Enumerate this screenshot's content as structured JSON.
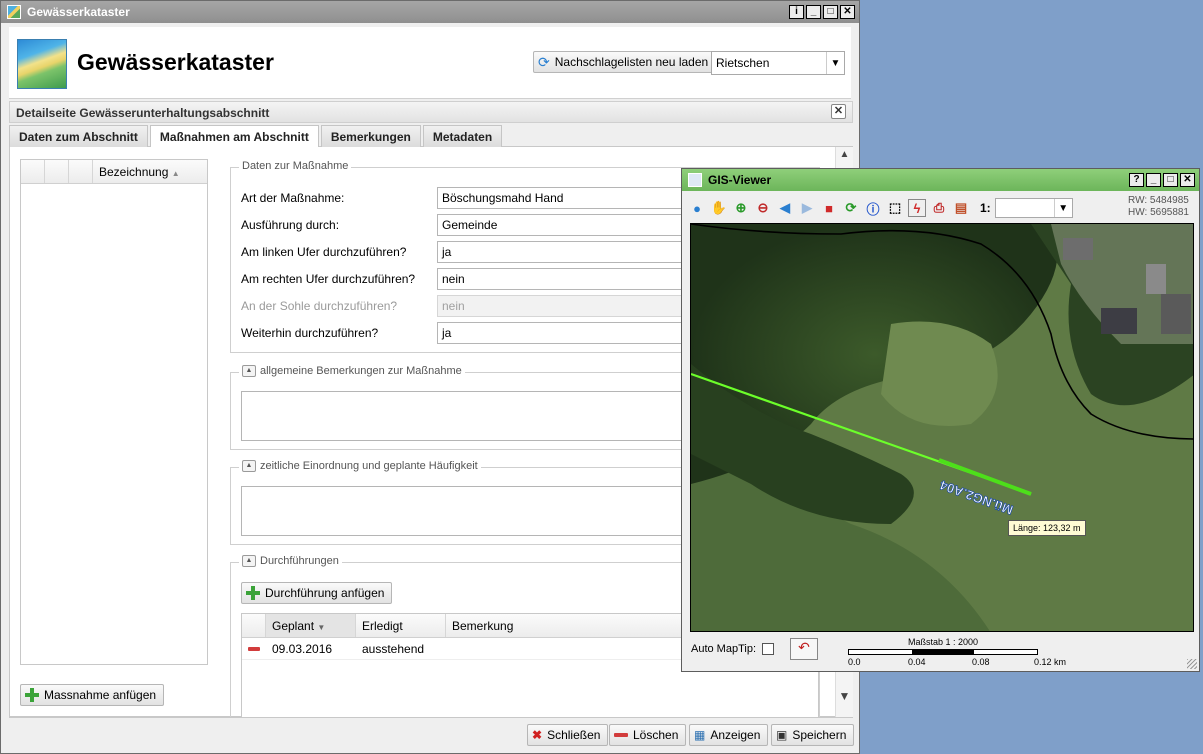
{
  "main_window": {
    "title": "Gewässerkataster",
    "app_title": "Gewässerkataster",
    "reload_button": "Nachschlagelisten neu laden",
    "location_select": "Rietschen",
    "panel_title": "Detailseite Gewässerunterhaltungsabschnitt",
    "tabs": [
      "Daten zum Abschnitt",
      "Maßnahmen am Abschnitt",
      "Bemerkungen",
      "Metadaten"
    ],
    "left_grid_header": "Bezeichnung",
    "add_measure_button": "Massnahme anfügen",
    "measure_section": {
      "legend": "Daten zur Maßnahme",
      "fields": [
        {
          "label": "Art der Maßnahme:",
          "value": "Böschungsmahd Hand"
        },
        {
          "label": "Ausführung durch:",
          "value": "Gemeinde"
        },
        {
          "label": "Am linken Ufer durchzuführen?",
          "value": "ja"
        },
        {
          "label": "Am rechten Ufer durchzuführen?",
          "value": "nein"
        },
        {
          "label": "An der Sohle durchzuführen?",
          "value": "nein"
        },
        {
          "label": "Weiterhin durchzuführen?",
          "value": "ja"
        }
      ]
    },
    "remarks_section": "allgemeine Bemerkungen zur Maßnahme",
    "schedule_section": "zeitliche Einordnung und geplante Häufigkeit",
    "executions_section": {
      "legend": "Durchführungen",
      "add_button": "Durchführung anfügen",
      "columns": [
        "Geplant",
        "Erledigt",
        "Bemerkung"
      ],
      "rows": [
        {
          "geplant": "09.03.2016",
          "erledigt": "ausstehend",
          "bemerkung": ""
        }
      ]
    },
    "footer_buttons": [
      "Schließen",
      "Löschen",
      "Anzeigen",
      "Speichern"
    ]
  },
  "gis_viewer": {
    "title": "GIS-Viewer",
    "scale_prefix": "1:",
    "rw": "RW: 5484985",
    "hw": "HW: 5695881",
    "segment_label": "Mü.NG2.A04",
    "length_tooltip": "Länge:  123,32 m",
    "auto_maptip_label": "Auto MapTip:",
    "scale_title": "Maßstab 1 : 2000",
    "scale_ticks": [
      "0.0",
      "0.04",
      "0.08",
      "0.12 km"
    ]
  },
  "colors": {
    "window_title_gray": "#9a9a9a",
    "gis_title_green": "#7cc26a",
    "segment_green": "#7dff3a",
    "desktop": "#7f9fc9"
  }
}
